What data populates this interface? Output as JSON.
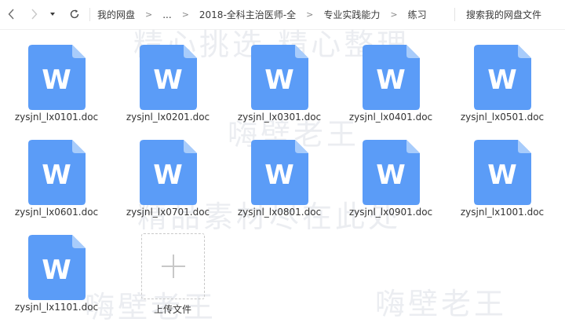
{
  "nav": {
    "back_icon": "chevron-left-icon",
    "forward_icon": "chevron-right-icon",
    "dropdown_icon": "caret-down-icon",
    "refresh_icon": "refresh-icon"
  },
  "breadcrumb": {
    "items": [
      {
        "label": "我的网盘"
      },
      {
        "label": "..."
      },
      {
        "label": "2018-全科主治医师-全"
      },
      {
        "label": "专业实践能力"
      },
      {
        "label": "练习"
      }
    ],
    "separator": ">"
  },
  "search": {
    "placeholder": "搜索我的网盘文件"
  },
  "colors": {
    "doc_blue": "#5b9cf7",
    "doc_fold": "#a8ccfb"
  },
  "files": [
    {
      "name": "zysjnl_lx0101.doc",
      "icon": "word-doc-icon",
      "glyph": "W"
    },
    {
      "name": "zysjnl_lx0201.doc",
      "icon": "word-doc-icon",
      "glyph": "W"
    },
    {
      "name": "zysjnl_lx0301.doc",
      "icon": "word-doc-icon",
      "glyph": "W"
    },
    {
      "name": "zysjnl_lx0401.doc",
      "icon": "word-doc-icon",
      "glyph": "W"
    },
    {
      "name": "zysjnl_lx0501.doc",
      "icon": "word-doc-icon",
      "glyph": "W"
    },
    {
      "name": "zysjnl_lx0601.doc",
      "icon": "word-doc-icon",
      "glyph": "W"
    },
    {
      "name": "zysjnl_lx0701.doc",
      "icon": "word-doc-icon",
      "glyph": "W"
    },
    {
      "name": "zysjnl_lx0801.doc",
      "icon": "word-doc-icon",
      "glyph": "W"
    },
    {
      "name": "zysjnl_lx0901.doc",
      "icon": "word-doc-icon",
      "glyph": "W"
    },
    {
      "name": "zysjnl_lx1001.doc",
      "icon": "word-doc-icon",
      "glyph": "W"
    },
    {
      "name": "zysjnl_lx1101.doc",
      "icon": "word-doc-icon",
      "glyph": "W"
    }
  ],
  "upload": {
    "label": "上传文件",
    "icon": "plus-icon"
  },
  "watermarks": [
    {
      "text": "精心挑选 精心整理"
    },
    {
      "text": "嗨壁老王"
    },
    {
      "text": "精品素材尽在此处"
    },
    {
      "text": "嗨壁老王"
    },
    {
      "text": "嗨壁老王"
    }
  ]
}
